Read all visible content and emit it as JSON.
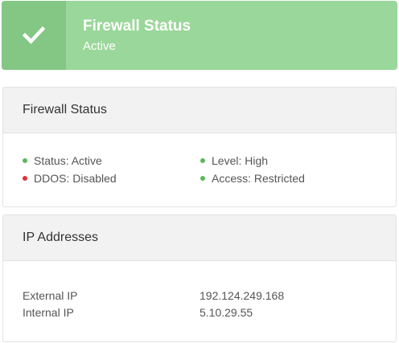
{
  "banner": {
    "icon": "check-icon",
    "title": "Firewall Status",
    "subtitle": "Active",
    "colors": {
      "background": "#9ad79a",
      "icon_box": "#84c784",
      "text": "#ffffff"
    }
  },
  "firewall_card": {
    "title": "Firewall Status",
    "items": [
      {
        "label": "Status: Active",
        "status": "ok",
        "color": "#5cb85c"
      },
      {
        "label": "Level: High",
        "status": "ok",
        "color": "#5cb85c"
      },
      {
        "label": "DDOS: Disabled",
        "status": "error",
        "color": "#e0323c"
      },
      {
        "label": "Access: Restricted",
        "status": "ok",
        "color": "#5cb85c"
      }
    ]
  },
  "ip_card": {
    "title": "IP Addresses",
    "rows": [
      {
        "label": "External IP",
        "value": "192.124.249.168"
      },
      {
        "label": "Internal IP",
        "value": "5.10.29.55"
      }
    ]
  }
}
